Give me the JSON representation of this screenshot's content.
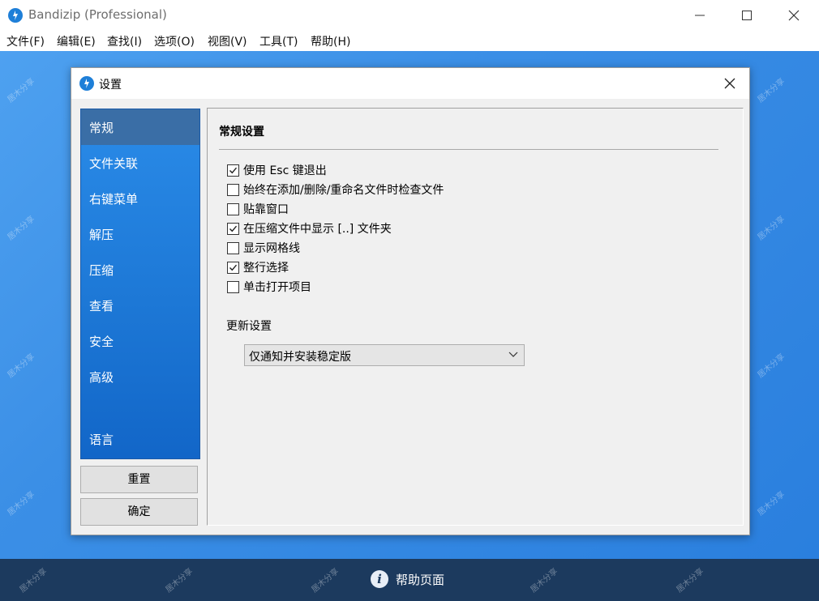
{
  "app": {
    "title": "Bandizip (Professional)",
    "menu": [
      "文件(F)",
      "编辑(E)",
      "查找(I)",
      "选项(O)",
      "视图(V)",
      "工具(T)",
      "帮助(H)"
    ],
    "footer_help": "帮助页面",
    "watermark": "居木分享"
  },
  "dialog": {
    "title": "设置",
    "nav": {
      "active_index": 0,
      "items": [
        "常规",
        "文件关联",
        "右键菜单",
        "解压",
        "压缩",
        "查看",
        "安全",
        "高级",
        "语言"
      ]
    },
    "buttons": {
      "reset": "重置",
      "ok": "确定"
    },
    "general": {
      "section_title": "常规设置",
      "options": [
        {
          "label": "使用 Esc 键退出",
          "checked": true
        },
        {
          "label": "始终在添加/删除/重命名文件时检查文件",
          "checked": false
        },
        {
          "label": "贴靠窗口",
          "checked": false
        },
        {
          "label": "在压缩文件中显示 [..] 文件夹",
          "checked": true
        },
        {
          "label": "显示网格线",
          "checked": false
        },
        {
          "label": "整行选择",
          "checked": true
        },
        {
          "label": "单击打开项目",
          "checked": false
        }
      ],
      "update_label": "更新设置",
      "update_value": "仅通知并安装稳定版"
    }
  },
  "colors": {
    "accent": "#1e7fd8",
    "nav_active": "#3a6ea6",
    "footer": "#1c3a5e"
  }
}
